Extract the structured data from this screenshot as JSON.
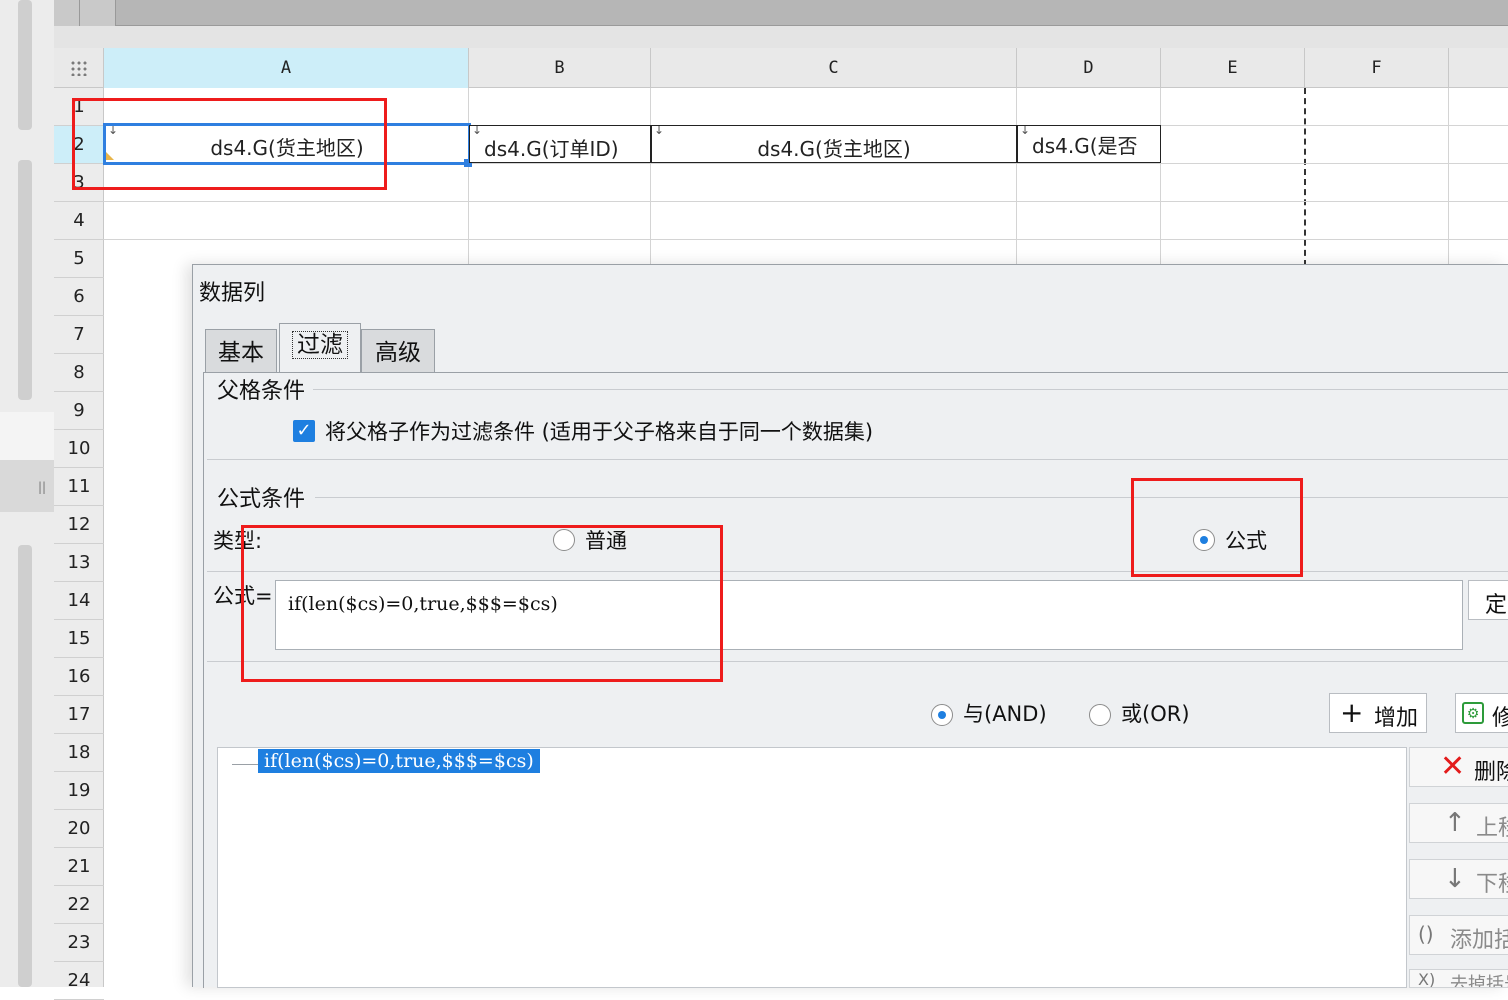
{
  "sheet": {
    "columns": [
      "A",
      "B",
      "C",
      "D",
      "E",
      "F"
    ],
    "rows": [
      "1",
      "2",
      "3",
      "4",
      "5",
      "6",
      "7",
      "8",
      "9",
      "10",
      "11",
      "12",
      "13",
      "14",
      "15",
      "16",
      "17",
      "18",
      "19",
      "20",
      "21",
      "22",
      "23",
      "24"
    ],
    "cells": {
      "a2": "ds4.G(货主地区)",
      "b2": "ds4.G(订单ID)",
      "c2": "ds4.G(货主地区)",
      "d2": "ds4.G(是否"
    },
    "expand_arrow": "↓"
  },
  "dialog": {
    "title": "数据列",
    "tabs": [
      "基本",
      "过滤",
      "高级"
    ],
    "active_tab": "过滤",
    "parent_group": {
      "title": "父格条件",
      "checkbox_label": "将父格子作为过滤条件 (适用于父子格来自于同一个数据集)",
      "checked": true
    },
    "formula_group": {
      "title": "公式条件",
      "type_label": "类型:",
      "option_normal": "普通",
      "option_formula": "公式",
      "selected": "公式",
      "formula_label": "公式=",
      "formula_value": "if(len($cs)=0,true,$$$=$cs)",
      "define_button": "定"
    },
    "logic": {
      "and_label": "与(AND)",
      "or_label": "或(OR)",
      "selected": "与(AND)"
    },
    "buttons": {
      "add": "增加",
      "modify": "修",
      "delete": "删除",
      "move_up": "上移",
      "move_down": "下移",
      "add_bracket": "添加括号",
      "remove_bracket": "去掉括号"
    },
    "conditions": [
      "if(len($cs)=0,true,$$$=$cs)"
    ]
  },
  "colors": {
    "accent": "#1e7fe0",
    "highlight_box": "#ee1c1c",
    "selected_header": "#cdeef9"
  }
}
